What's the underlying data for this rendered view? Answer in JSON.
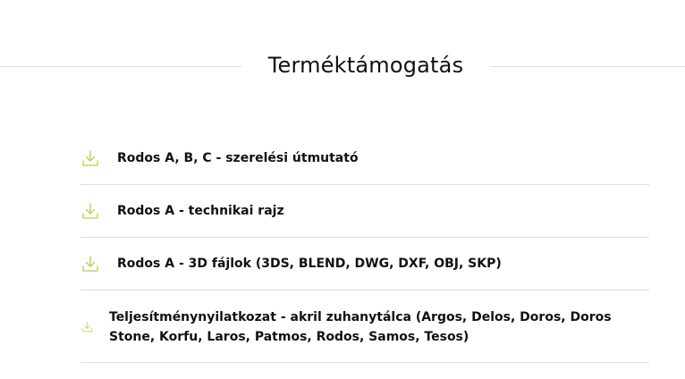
{
  "section": {
    "title": "Terméktámogatás"
  },
  "colors": {
    "accent": "#b8cf4a",
    "divider": "#dcdcdc",
    "text": "#111111"
  },
  "downloads": [
    {
      "label": "Rodos A, B, C - szerelési útmutató",
      "icon": "download-icon"
    },
    {
      "label": "Rodos A - technikai rajz",
      "icon": "download-icon"
    },
    {
      "label": "Rodos A - 3D fájlok (3DS, BLEND, DWG, DXF, OBJ, SKP)",
      "icon": "download-icon"
    },
    {
      "label": "Teljesítménynyilatkozat - akril zuhanytálca (Argos, Delos, Doros, Doros Stone, Korfu, Laros, Patmos, Rodos, Samos, Tesos)",
      "icon": "download-icon"
    }
  ]
}
